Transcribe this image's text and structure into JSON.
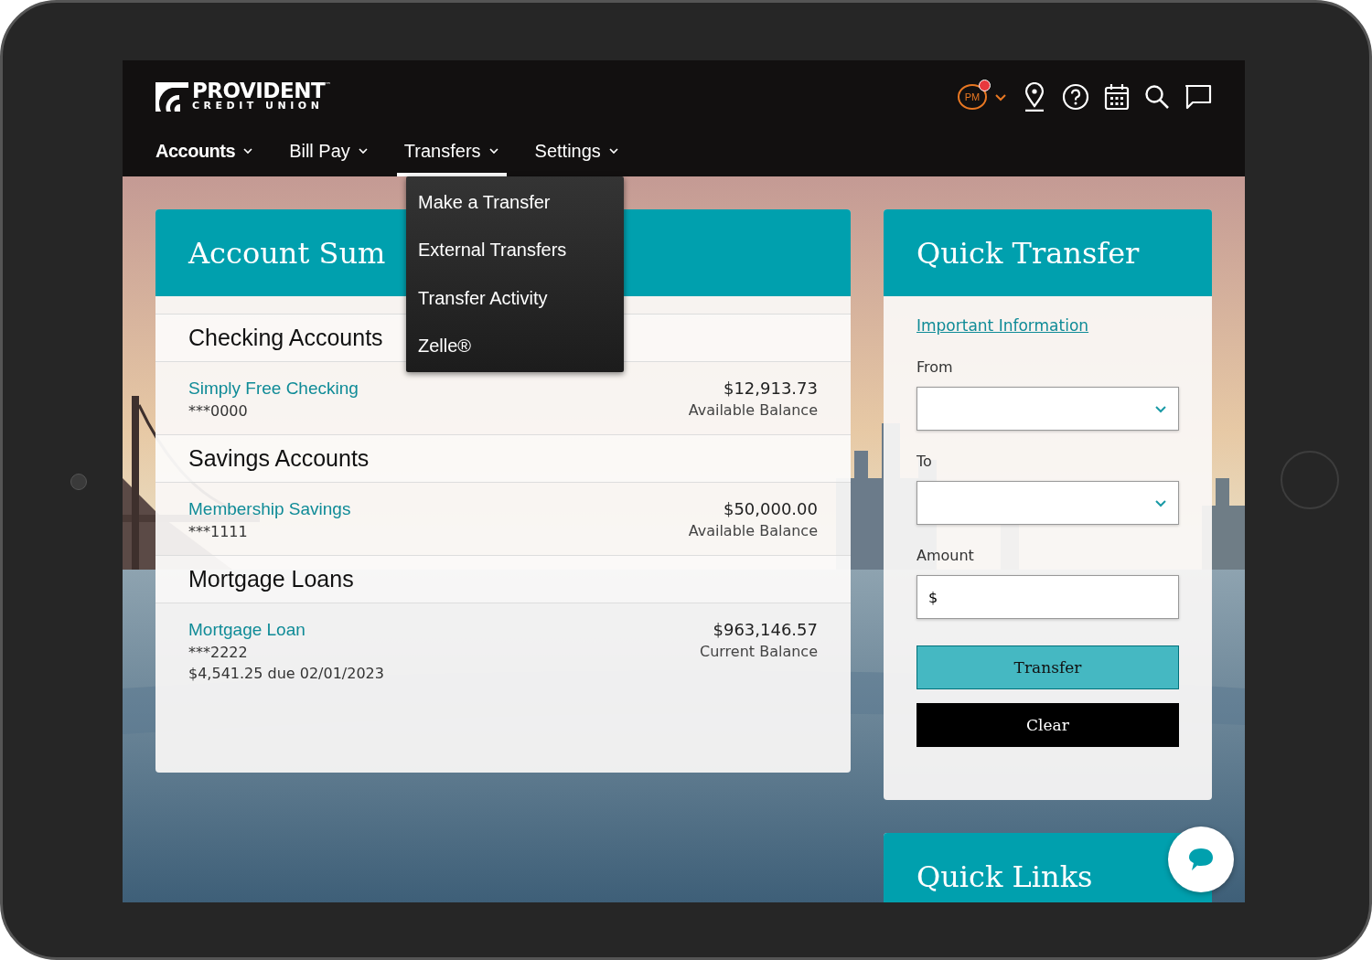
{
  "brand": {
    "name": "PROVIDENT",
    "trademark": "™",
    "tagline": "CREDIT UNION"
  },
  "user": {
    "initials": "PM",
    "notification": true
  },
  "nav": [
    {
      "label": "Accounts",
      "current": true,
      "selected": false
    },
    {
      "label": "Bill Pay",
      "current": false,
      "selected": false
    },
    {
      "label": "Transfers",
      "current": false,
      "selected": true
    },
    {
      "label": "Settings",
      "current": false,
      "selected": false
    }
  ],
  "transfers_menu": [
    "Make a Transfer",
    "External Transfers",
    "Transfer Activity",
    "Zelle®"
  ],
  "account_summary": {
    "title": "Account Sum",
    "groups": [
      {
        "title": "Checking Accounts",
        "accounts": [
          {
            "name": "Simply Free Checking",
            "number": "***0000",
            "balance": "$12,913.73",
            "balance_label": "Available Balance"
          }
        ]
      },
      {
        "title": "Savings Accounts",
        "accounts": [
          {
            "name": "Membership Savings",
            "number": "***1111",
            "balance": "$50,000.00",
            "balance_label": "Available Balance"
          }
        ]
      },
      {
        "title": "Mortgage Loans",
        "accounts": [
          {
            "name": "Mortgage Loan",
            "number": "***2222",
            "note": "$4,541.25 due 02/01/2023",
            "balance": "$963,146.57",
            "balance_label": "Current Balance"
          }
        ]
      }
    ]
  },
  "quick_transfer": {
    "title": "Quick Transfer",
    "link": "Important Information",
    "fields": [
      {
        "label": "From",
        "kind": "select"
      },
      {
        "label": "To",
        "kind": "select"
      },
      {
        "label": "Amount",
        "kind": "amount",
        "prefix": "$"
      }
    ],
    "buttons": [
      {
        "label": "Transfer",
        "kind": "primary"
      },
      {
        "label": "Clear",
        "kind": "secondary"
      }
    ]
  },
  "quick_links": {
    "title": "Quick Links"
  }
}
